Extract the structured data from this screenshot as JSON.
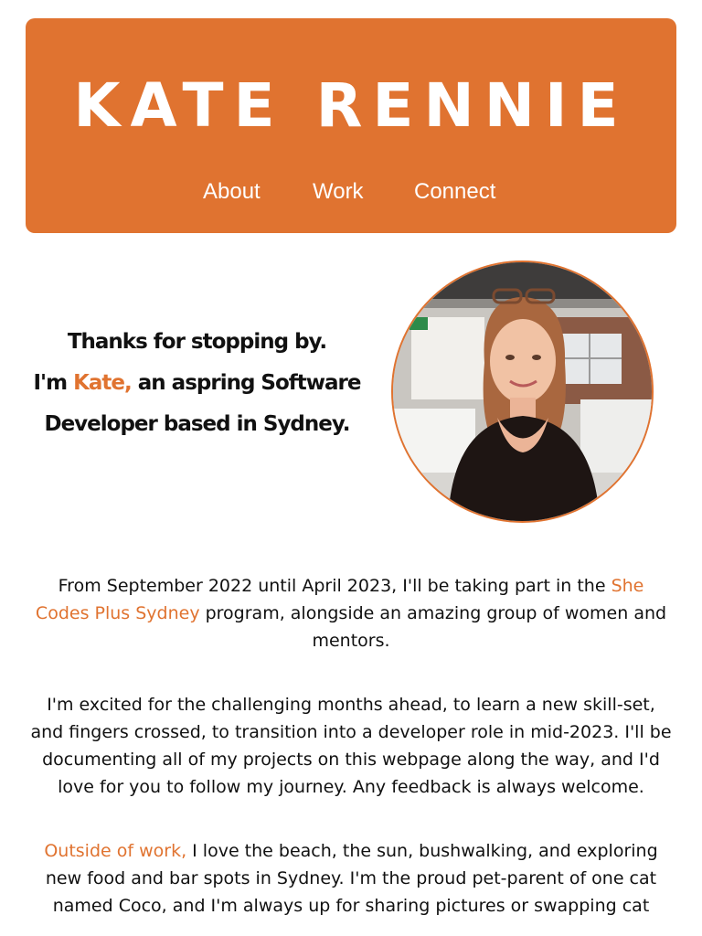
{
  "header": {
    "title": "KATE RENNIE",
    "nav": [
      {
        "label": "About"
      },
      {
        "label": "Work"
      },
      {
        "label": "Connect"
      }
    ]
  },
  "intro": {
    "line1": "Thanks for stopping by.",
    "line2_prefix": "I'm ",
    "line2_name": "Kate,",
    "line2_suffix": " an aspring Software",
    "line3": "Developer based in Sydney."
  },
  "avatar": {
    "icon": "profile-photo"
  },
  "bio": {
    "p1_before": "From September 2022 until April 2023, I'll be taking part in the ",
    "p1_link": "She Codes Plus Sydney",
    "p1_after": " program, alongside an amazing group of women and mentors.",
    "p2": "I'm excited for the challenging months ahead, to learn a new skill-set, and fingers crossed, to transition into a developer role in mid-2023. I'll be documenting all of my projects on this webpage along the way, and I'd love for you to follow my journey. Any feedback is always welcome.",
    "p3_link": "Outside of work,",
    "p3_after": " I love the beach, the sun, bushwalking, and exploring new food and bar spots in Sydney. I'm the proud pet-parent of one cat named Coco, and I'm always up for sharing pictures or swapping cat"
  },
  "colors": {
    "accent": "#e07330",
    "text": "#111111",
    "background": "#ffffff"
  }
}
